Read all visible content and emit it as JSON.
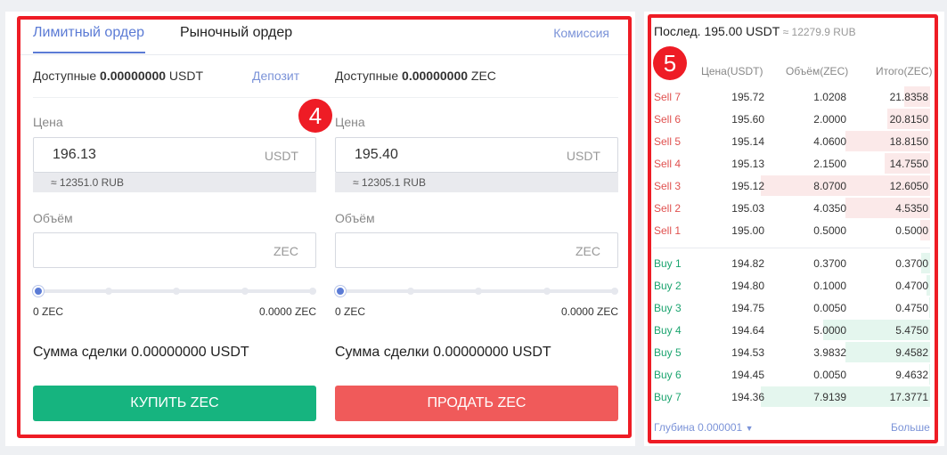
{
  "tabs": {
    "limit_order": "Лимитный ордер",
    "market_order": "Рыночный ордер",
    "fee": "Комиссия"
  },
  "buy": {
    "available_prefix": "Доступные ",
    "available_amount": "0.00000000",
    "available_unit": " USDT",
    "deposit": "Депозит",
    "price_label": "Цена",
    "price_value": "196.13",
    "price_unit": "USDT",
    "price_conversion": "≈ 12351.0 RUB",
    "volume_label": "Объём",
    "volume_value": "",
    "volume_unit": "ZEC",
    "slider_min": "0 ZEC",
    "slider_max": "0.0000 ZEC",
    "slider_fraction": 0,
    "sum": "Сумма сделки 0.00000000 USDT",
    "button": "КУПИТЬ ZEC"
  },
  "sell": {
    "available_prefix": "Доступные ",
    "available_amount": "0.00000000",
    "available_unit": " ZEC",
    "price_label": "Цена",
    "price_value": "195.40",
    "price_unit": "USDT",
    "price_conversion": "≈ 12305.1 RUB",
    "volume_label": "Объём",
    "volume_value": "",
    "volume_unit": "ZEC",
    "slider_min": "0 ZEC",
    "slider_max": "0.0000 ZEC",
    "slider_fraction": 0,
    "sum": "Сумма сделки 0.00000000 USDT",
    "button": "ПРОДАТЬ ZEC"
  },
  "annotations": {
    "left_badge": "4",
    "right_badge": "5"
  },
  "orderbook": {
    "last_label": "Послед. 195.00 USDT",
    "last_rub": " ≈ 12279.9 RUB",
    "headers": {
      "price": "Цена(USDT)",
      "volume": "Объём(ZEC)",
      "total": "Итого(ZEC)"
    },
    "sells": [
      {
        "label": "Sell 7",
        "price": "195.72",
        "volume": "1.0208",
        "total": "21.8358",
        "bar": 0.15
      },
      {
        "label": "Sell 6",
        "price": "195.60",
        "volume": "2.0000",
        "total": "20.8150",
        "bar": 0.25
      },
      {
        "label": "Sell 5",
        "price": "195.14",
        "volume": "4.0600",
        "total": "18.8150",
        "bar": 0.5
      },
      {
        "label": "Sell 4",
        "price": "195.13",
        "volume": "2.1500",
        "total": "14.7550",
        "bar": 0.27
      },
      {
        "label": "Sell 3",
        "price": "195.12",
        "volume": "8.0700",
        "total": "12.6050",
        "bar": 1.0
      },
      {
        "label": "Sell 2",
        "price": "195.03",
        "volume": "4.0350",
        "total": "4.5350",
        "bar": 0.5
      },
      {
        "label": "Sell 1",
        "price": "195.00",
        "volume": "0.5000",
        "total": "0.5000",
        "bar": 0.06
      }
    ],
    "buys": [
      {
        "label": "Buy 1",
        "price": "194.82",
        "volume": "0.3700",
        "total": "0.3700",
        "bar": 0.05
      },
      {
        "label": "Buy 2",
        "price": "194.80",
        "volume": "0.1000",
        "total": "0.4700",
        "bar": 0.02
      },
      {
        "label": "Buy 3",
        "price": "194.75",
        "volume": "0.0050",
        "total": "0.4750",
        "bar": 0.005
      },
      {
        "label": "Buy 4",
        "price": "194.64",
        "volume": "5.0000",
        "total": "5.4750",
        "bar": 0.63
      },
      {
        "label": "Buy 5",
        "price": "194.53",
        "volume": "3.9832",
        "total": "9.4582",
        "bar": 0.5
      },
      {
        "label": "Buy 6",
        "price": "194.45",
        "volume": "0.0050",
        "total": "9.4632",
        "bar": 0.005
      },
      {
        "label": "Buy 7",
        "price": "194.36",
        "volume": "7.9139",
        "total": "17.3771",
        "bar": 1.0
      }
    ],
    "depth": "Глубина 0.000001",
    "more": "Больше"
  }
}
